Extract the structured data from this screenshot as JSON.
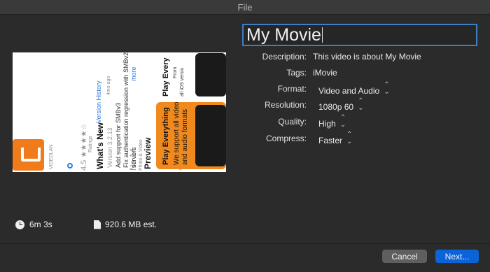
{
  "window": {
    "title": "File"
  },
  "thumbnail": {
    "texts": {
      "whats_new": "What's New",
      "version": "Version 3.2.13",
      "note1": "Add support for SMBv3",
      "note2": "Fix authentication regression with SMBv2",
      "note3": "servers",
      "rating": "4.5 ★★★★☆",
      "ratings_small": "Ratings",
      "rank": "No 14",
      "rank_small": "Photo & Video",
      "age": "4+",
      "version_history": "Version History",
      "ago": "4mo ago",
      "more": "more",
      "preview": "Preview",
      "play_everything": "Play Everything",
      "we_support": "We support all video",
      "audio_formats": "and audio formats",
      "play_every_top": "Play Every",
      "from": "From",
      "ios": "all iOS versio",
      "vlc": "VIDEOLAN"
    }
  },
  "form": {
    "title_value": "My Movie",
    "fields": [
      {
        "label": "Description:",
        "value": "This video is about My Movie",
        "popup": false
      },
      {
        "label": "Tags:",
        "value": "iMovie",
        "popup": false
      },
      {
        "label": "Format:",
        "value": "Video and Audio",
        "popup": true
      },
      {
        "label": "Resolution:",
        "value": "1080p 60",
        "popup": true
      },
      {
        "label": "Quality:",
        "value": "High",
        "popup": true
      },
      {
        "label": "Compress:",
        "value": "Faster",
        "popup": true
      }
    ]
  },
  "stats": {
    "duration": "6m 3s",
    "size": "920.6 MB est."
  },
  "buttons": {
    "cancel": "Cancel",
    "next": "Next..."
  },
  "icons": {
    "duration": "clock-icon",
    "size": "file-icon",
    "popup": "up-down-chevron-icon"
  },
  "colors": {
    "background": "#2b2b2b",
    "accent": "#0a64d8",
    "focus_ring": "#3b7fc4",
    "thumbnail_orange": "#f07b1a"
  }
}
